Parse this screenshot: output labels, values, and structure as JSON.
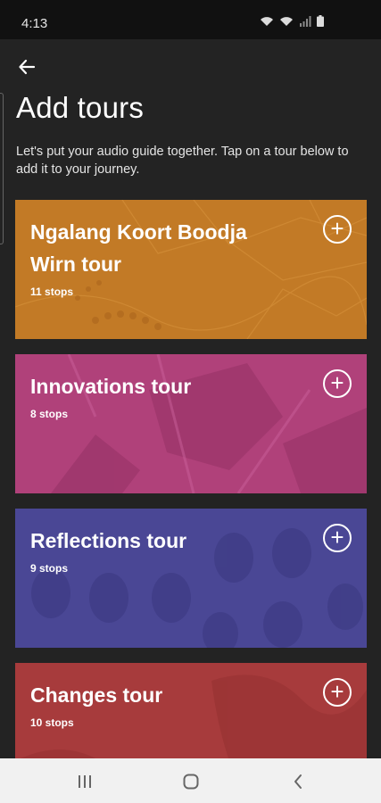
{
  "status": {
    "time": "4:13"
  },
  "header": {
    "title": "Add tours",
    "subtitle": "Let's put your audio guide together. Tap on a tour below to add it to your journey."
  },
  "tours": [
    {
      "title": "Ngalang Koort Boodja Wirn tour",
      "stops": "11 stops",
      "color": "#c27a26"
    },
    {
      "title": "Innovations tour",
      "stops": "8 stops",
      "color": "#b0417a"
    },
    {
      "title": "Reflections tour",
      "stops": "9 stops",
      "color": "#4a4795"
    },
    {
      "title": "Changes tour",
      "stops": "10 stops",
      "color": "#a73b3c"
    }
  ],
  "icons": {
    "back": "arrow-left-icon",
    "add": "plus-circle-icon",
    "recents": "recent-apps-icon",
    "home": "home-icon",
    "nav_back": "chevron-left-icon"
  }
}
